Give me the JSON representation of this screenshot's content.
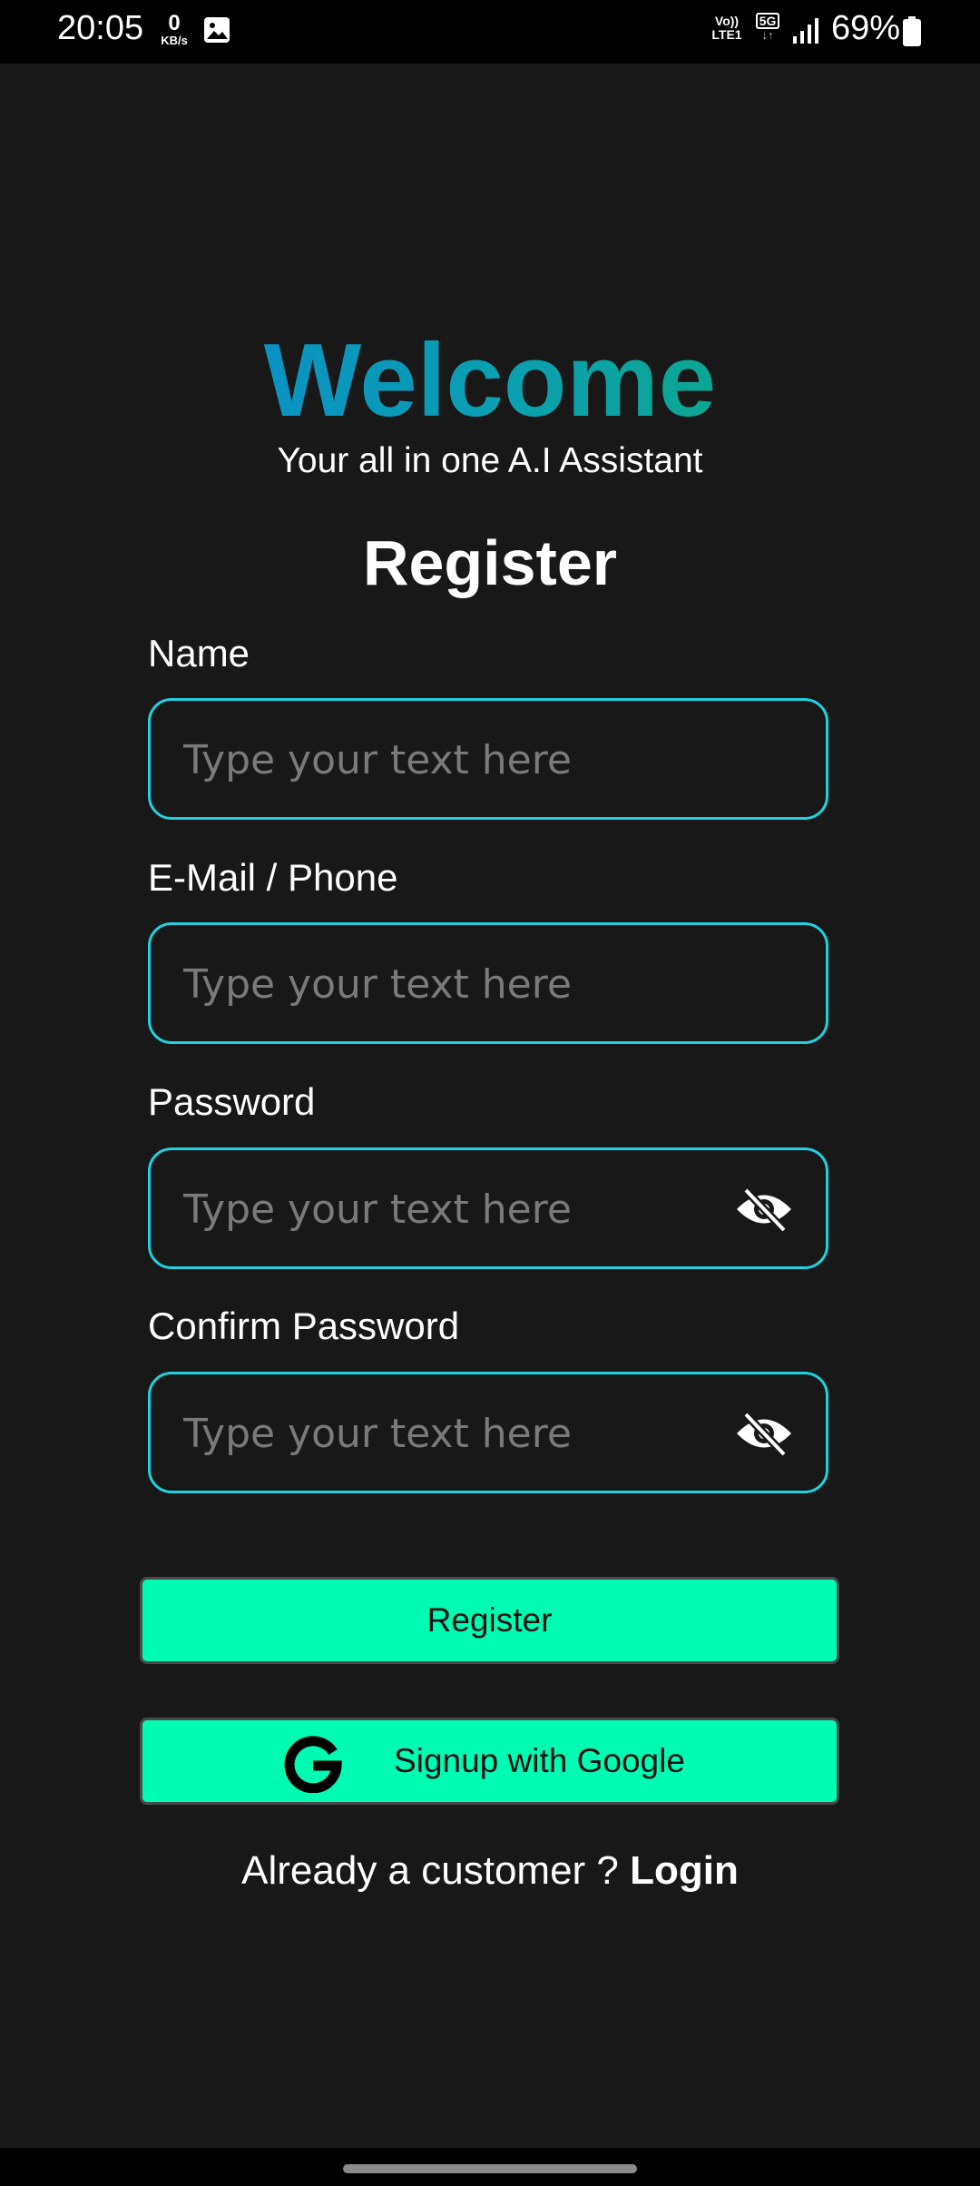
{
  "status_bar": {
    "time": "20:05",
    "net_speed_value": "0",
    "net_speed_unit": "KB/s",
    "volte_line1": "Vo))",
    "volte_line2": "LTE1",
    "network": "5G",
    "battery_pct": "69%",
    "icons": [
      "image-icon",
      "signal-icon",
      "battery-icon"
    ]
  },
  "header": {
    "welcome": "Welcome",
    "welcome_gradient": [
      "#0a84d6",
      "#0a9fb2",
      "#0fb06f"
    ],
    "tagline": "Your all in one A.I Assistant",
    "title": "Register"
  },
  "form": {
    "name_label": "Name",
    "name_placeholder": "Type your text here",
    "email_label": "E-Mail / Phone",
    "email_placeholder": "Type your text here",
    "password_label": "Password",
    "password_placeholder": "Type your text here",
    "confirm_label": "Confirm Password",
    "confirm_placeholder": "Type your text here",
    "field_border_color": "#1ed2e0"
  },
  "actions": {
    "register_label": "Register",
    "google_label": "Signup with Google",
    "button_color": "#00fcb2",
    "login_prompt": "Already a customer ?",
    "login_link": "Login"
  }
}
